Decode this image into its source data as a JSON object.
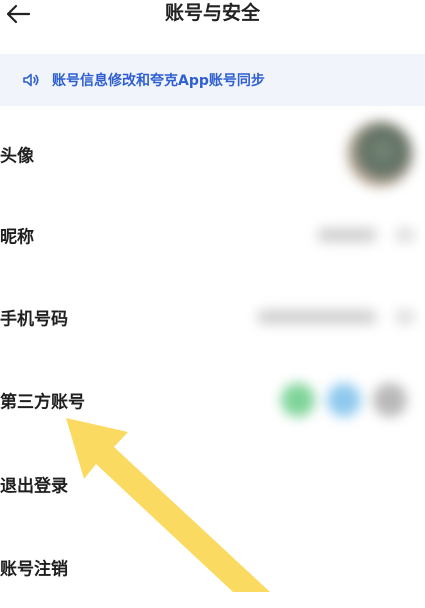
{
  "header": {
    "title": "账号与安全",
    "back_icon": "arrow-left-icon"
  },
  "banner": {
    "icon": "speaker-icon",
    "text": "账号信息修改和夸克App账号同步"
  },
  "rows": [
    {
      "label": "头像",
      "value_type": "avatar"
    },
    {
      "label": "昵称",
      "value_type": "blurred-text"
    },
    {
      "label": "手机号码",
      "value_type": "blurred-text"
    },
    {
      "label": "第三方账号",
      "value_type": "third-party-icons"
    },
    {
      "label": "退出登录",
      "value_type": "none"
    },
    {
      "label": "账号注销",
      "value_type": "none"
    }
  ],
  "colors": {
    "accent": "#2f5fd0",
    "banner_bg": "#f1f5fb",
    "annotation_arrow": "#fbd85a"
  }
}
